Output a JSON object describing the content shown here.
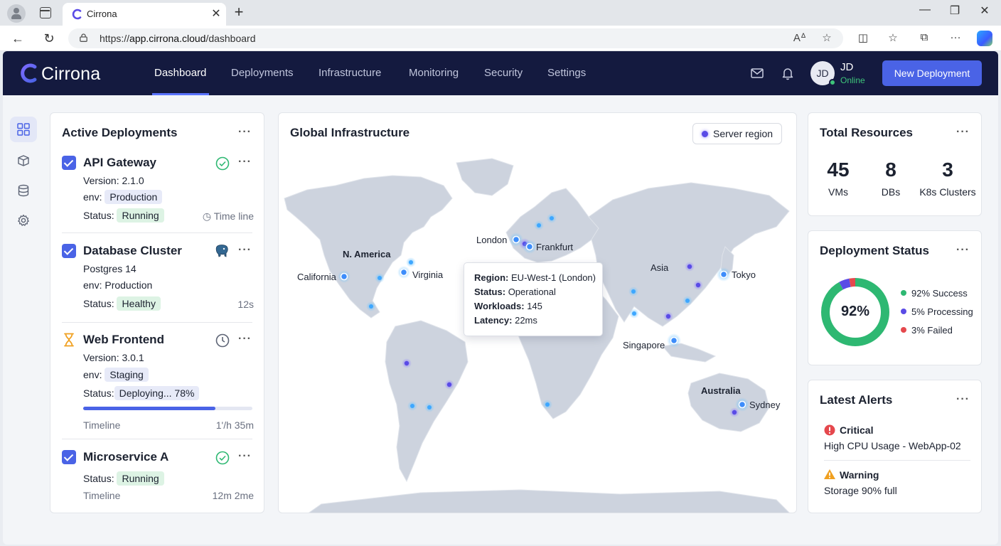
{
  "browser": {
    "tab_title": "Cirrona",
    "url_prefix": "https://",
    "url_host": "app.cirrona.cloud",
    "url_path": "/dashboard"
  },
  "header": {
    "brand": "Cirrona",
    "nav": [
      "Dashboard",
      "Deployments",
      "Infrastructure",
      "Monitoring",
      "Security",
      "Settings"
    ],
    "active_nav": "Dashboard",
    "user_initials": "JD",
    "user_name": "JD",
    "user_status": "Online",
    "new_deployment_label": "New Deployment"
  },
  "sidebar": {
    "icons": [
      "grid-icon",
      "box-icon",
      "database-icon",
      "gear-icon"
    ]
  },
  "deployments": {
    "title": "Active Deployments",
    "items": [
      {
        "name": "API Gateway",
        "line1": "Version: 2.1.0",
        "env_label": "env:",
        "env_value": "Production",
        "status_label": "Status:",
        "status_value": "Running",
        "meta": "Time line"
      },
      {
        "name": "Database Cluster",
        "line1": "Postgres 14",
        "env_label": "env:",
        "env_value": "Production",
        "status_label": "Status:",
        "status_value": "Healthy",
        "meta": "12s"
      },
      {
        "name": "Web Frontend",
        "line1": "Version: 3.0.1",
        "env_label": "env:",
        "env_value": "Staging",
        "status_label": "Status:",
        "status_value": "Deploying... 78%",
        "progress": 0.78,
        "meta_label": "Timeline",
        "meta": "1'/h 35m"
      },
      {
        "name": "Microservice A",
        "status_label": "Status:",
        "status_value": "Running",
        "meta_label": "Timeline",
        "meta": "12m 2me"
      }
    ]
  },
  "map": {
    "title": "Global Infrastructure",
    "legend": "Server region",
    "labels": {
      "n_america": "N. America",
      "california": "California",
      "virginia": "Virginia",
      "london": "London",
      "frankfurt": "Frankfurt",
      "asia": "Asia",
      "tokyo": "Tokyo",
      "singapore": "Singapore",
      "australia": "Australia",
      "sydney": "Sydney"
    },
    "tooltip": {
      "region_label": "Region:",
      "region_value": "EU-West-1 (London)",
      "status_label": "Status:",
      "status_value": "Operational",
      "workloads_label": "Workloads:",
      "workloads_value": "145",
      "latency_label": "Latency:",
      "latency_value": "22ms"
    }
  },
  "resources": {
    "title": "Total Resources",
    "items": [
      {
        "value": "45",
        "label": "VMs"
      },
      {
        "value": "8",
        "label": "DBs"
      },
      {
        "value": "3",
        "label": "K8s Clusters"
      }
    ]
  },
  "deployment_status": {
    "title": "Deployment Status",
    "center": "92%",
    "segments": [
      {
        "label": "92% Success",
        "value": 92,
        "color": "#2eb872"
      },
      {
        "label": "5% Processing",
        "value": 5,
        "color": "#5a4be6"
      },
      {
        "label": "3% Failed",
        "value": 3,
        "color": "#e5484d"
      }
    ]
  },
  "alerts": {
    "title": "Latest Alerts",
    "items": [
      {
        "severity": "Critical",
        "text": "High CPU Usage - WebApp-02",
        "color": "#e5484d"
      },
      {
        "severity": "Warning",
        "text": "Storage 90% full",
        "color": "#f0a020"
      }
    ]
  }
}
